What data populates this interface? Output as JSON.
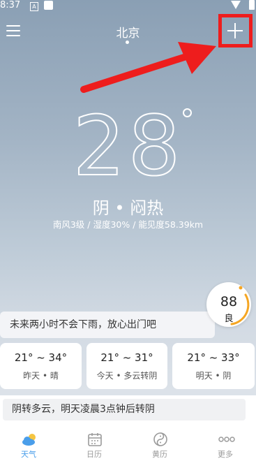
{
  "status_bar": {
    "time": "8:37",
    "notification_letter": "A"
  },
  "header": {
    "city": "北京"
  },
  "current": {
    "temperature": "28",
    "condition": "阴 • 闷热",
    "details": "南风3级  /  湿度30%  /  能见度58.39km"
  },
  "aqi": {
    "value": "88",
    "level": "良"
  },
  "rain_forecast": "未来两小时不会下雨，放心出门吧",
  "daily": [
    {
      "range": "21° ~ 34°",
      "desc": "昨天 • 晴"
    },
    {
      "range": "21° ~ 31°",
      "desc": "今天 • 多云转阴"
    },
    {
      "range": "21° ~ 33°",
      "desc": "明天 • 阴"
    }
  ],
  "forecast_text": "阴转多云，明天凌晨3点钟后转阴",
  "tabs": [
    {
      "label": "天气",
      "icon": "weather-icon",
      "active": true
    },
    {
      "label": "日历",
      "icon": "calendar-icon",
      "active": false
    },
    {
      "label": "黄历",
      "icon": "almanac-icon",
      "active": false
    },
    {
      "label": "更多",
      "icon": "more-icon",
      "active": false
    }
  ],
  "colors": {
    "accent": "#4a9eea",
    "annotation": "#ee1d1d",
    "aqi_ring": "#f5a623"
  }
}
